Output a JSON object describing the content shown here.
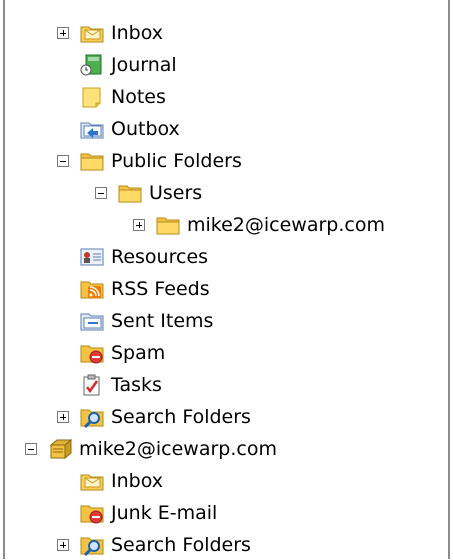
{
  "items": [
    {
      "label": "Inbox",
      "icon": "inbox-icon",
      "toggle": "expand"
    },
    {
      "label": "Journal",
      "icon": "journal-icon",
      "toggle": null
    },
    {
      "label": "Notes",
      "icon": "notes-icon",
      "toggle": null
    },
    {
      "label": "Outbox",
      "icon": "outbox-icon",
      "toggle": null
    },
    {
      "label": "Public Folders",
      "icon": "folder-icon",
      "toggle": "collapse"
    },
    {
      "label": "Users",
      "icon": "folder-icon",
      "toggle": "collapse"
    },
    {
      "label": "mike2@icewarp.com",
      "icon": "folder-icon",
      "toggle": "expand"
    },
    {
      "label": "Resources",
      "icon": "resources-icon",
      "toggle": null
    },
    {
      "label": "RSS Feeds",
      "icon": "rss-feeds-icon",
      "toggle": null
    },
    {
      "label": "Sent Items",
      "icon": "sent-items-icon",
      "toggle": null
    },
    {
      "label": "Spam",
      "icon": "spam-icon",
      "toggle": null
    },
    {
      "label": "Tasks",
      "icon": "tasks-icon",
      "toggle": null
    },
    {
      "label": "Search Folders",
      "icon": "search-folder-icon",
      "toggle": "expand"
    },
    {
      "label": "mike2@icewarp.com",
      "icon": "mailbox-icon",
      "toggle": "collapse"
    },
    {
      "label": "Inbox",
      "icon": "inbox-icon",
      "toggle": null
    },
    {
      "label": "Junk E-mail",
      "icon": "junk-email-icon",
      "toggle": null
    },
    {
      "label": "Search Folders",
      "icon": "search-folder-icon",
      "toggle": "expand"
    }
  ]
}
